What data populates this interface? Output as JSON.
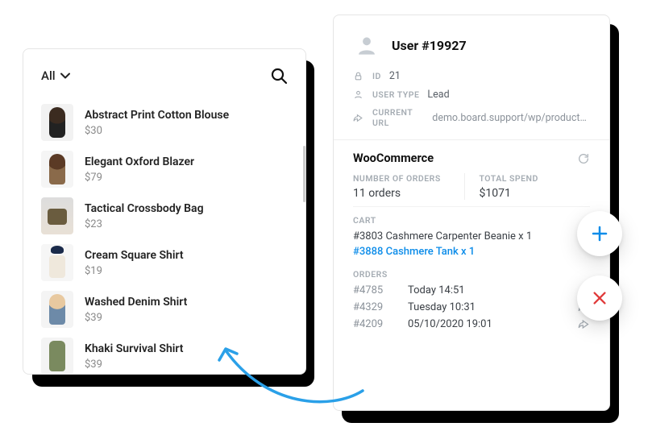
{
  "left": {
    "filter_label": "All",
    "products": [
      {
        "name": "Abstract Print Cotton Blouse",
        "price": "$30"
      },
      {
        "name": "Elegant Oxford Blazer",
        "price": "$79"
      },
      {
        "name": "Tactical Crossbody Bag",
        "price": "$23"
      },
      {
        "name": "Cream Square Shirt",
        "price": "$19"
      },
      {
        "name": "Washed Denim Shirt",
        "price": "$39"
      },
      {
        "name": "Khaki Survival Shirt",
        "price": "$39"
      }
    ]
  },
  "right": {
    "user_title": "User #19927",
    "id_label": "ID",
    "id_value": "21",
    "type_label": "USER TYPE",
    "type_value": "Lead",
    "url_label": "CURRENT URL",
    "url_value": "demo.board.support/wp/product/cash...",
    "woo_title": "WooCommerce",
    "orders_count_label": "NUMBER OF ORDERS",
    "orders_count_value": "11 orders",
    "spend_label": "TOTAL SPEND",
    "spend_value": "$1071",
    "cart_label": "CART",
    "cart": [
      {
        "text": "#3803 Cashmere Carpenter Beanie x 1",
        "link": false
      },
      {
        "text": "#3888 Cashmere Tank x 1",
        "link": true
      }
    ],
    "orders_label": "ORDERS",
    "orders": [
      {
        "id": "#4785",
        "date": "Today 14:51",
        "share": false
      },
      {
        "id": "#4329",
        "date": "Tuesday 10:31",
        "share": true
      },
      {
        "id": "#4209",
        "date": "05/10/2020 19:01",
        "share": true
      }
    ]
  }
}
